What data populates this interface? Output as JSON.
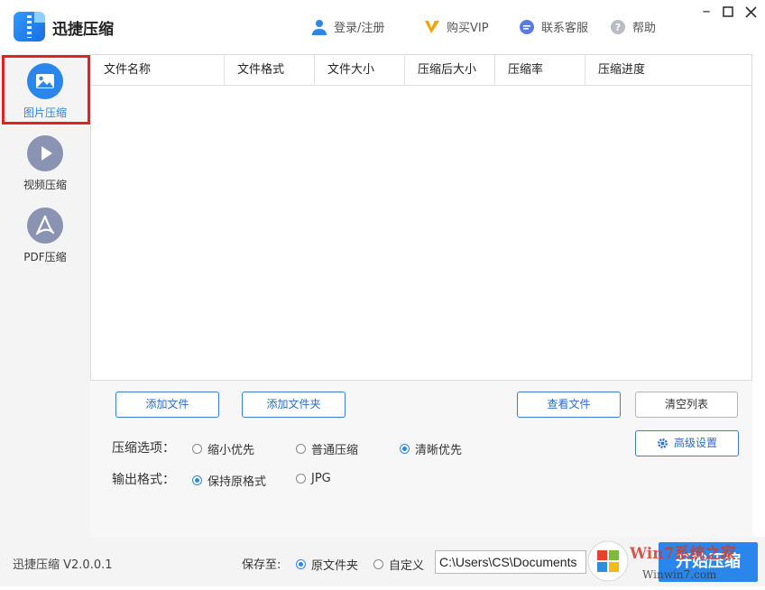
{
  "app": {
    "title": "迅捷压缩"
  },
  "titlebar": {
    "login": "登录/注册",
    "vip": "购买VIP",
    "service": "联系客服",
    "help": "帮助"
  },
  "sidebar": {
    "items": [
      {
        "label": "图片压缩",
        "icon": "image-icon",
        "active": true
      },
      {
        "label": "视频压缩",
        "icon": "play-icon",
        "active": false
      },
      {
        "label": "PDF压缩",
        "icon": "pdf-icon",
        "active": false
      }
    ]
  },
  "table": {
    "columns": [
      "文件名称",
      "文件格式",
      "文件大小",
      "压缩后大小",
      "压缩率",
      "压缩进度"
    ],
    "rows": []
  },
  "controls": {
    "add_file": "添加文件",
    "add_folder": "添加文件夹",
    "view_file": "查看文件",
    "clear_list": "清空列表",
    "advanced": "高级设置",
    "compress_option_label": "压缩选项：",
    "compress_options": [
      "缩小优先",
      "普通压缩",
      "清晰优先"
    ],
    "compress_selected": "清晰优先",
    "output_format_label": "输出格式：",
    "output_formats": [
      "保持原格式",
      "JPG"
    ],
    "output_selected": "保持原格式"
  },
  "footer": {
    "version": "迅捷压缩 V2.0.0.1",
    "save_to_label": "保存至:",
    "save_options": [
      "原文件夹",
      "自定义"
    ],
    "save_selected": "原文件夹",
    "path_value": "C:\\Users\\CS\\Documents",
    "start_button": "开始压缩"
  },
  "watermark": {
    "brand": "Win7系统之家",
    "site": "Winwin7.com"
  },
  "colors": {
    "accent": "#2a86ea",
    "highlight": "#e02222",
    "sidebar_bg": "#f4f4f4"
  }
}
